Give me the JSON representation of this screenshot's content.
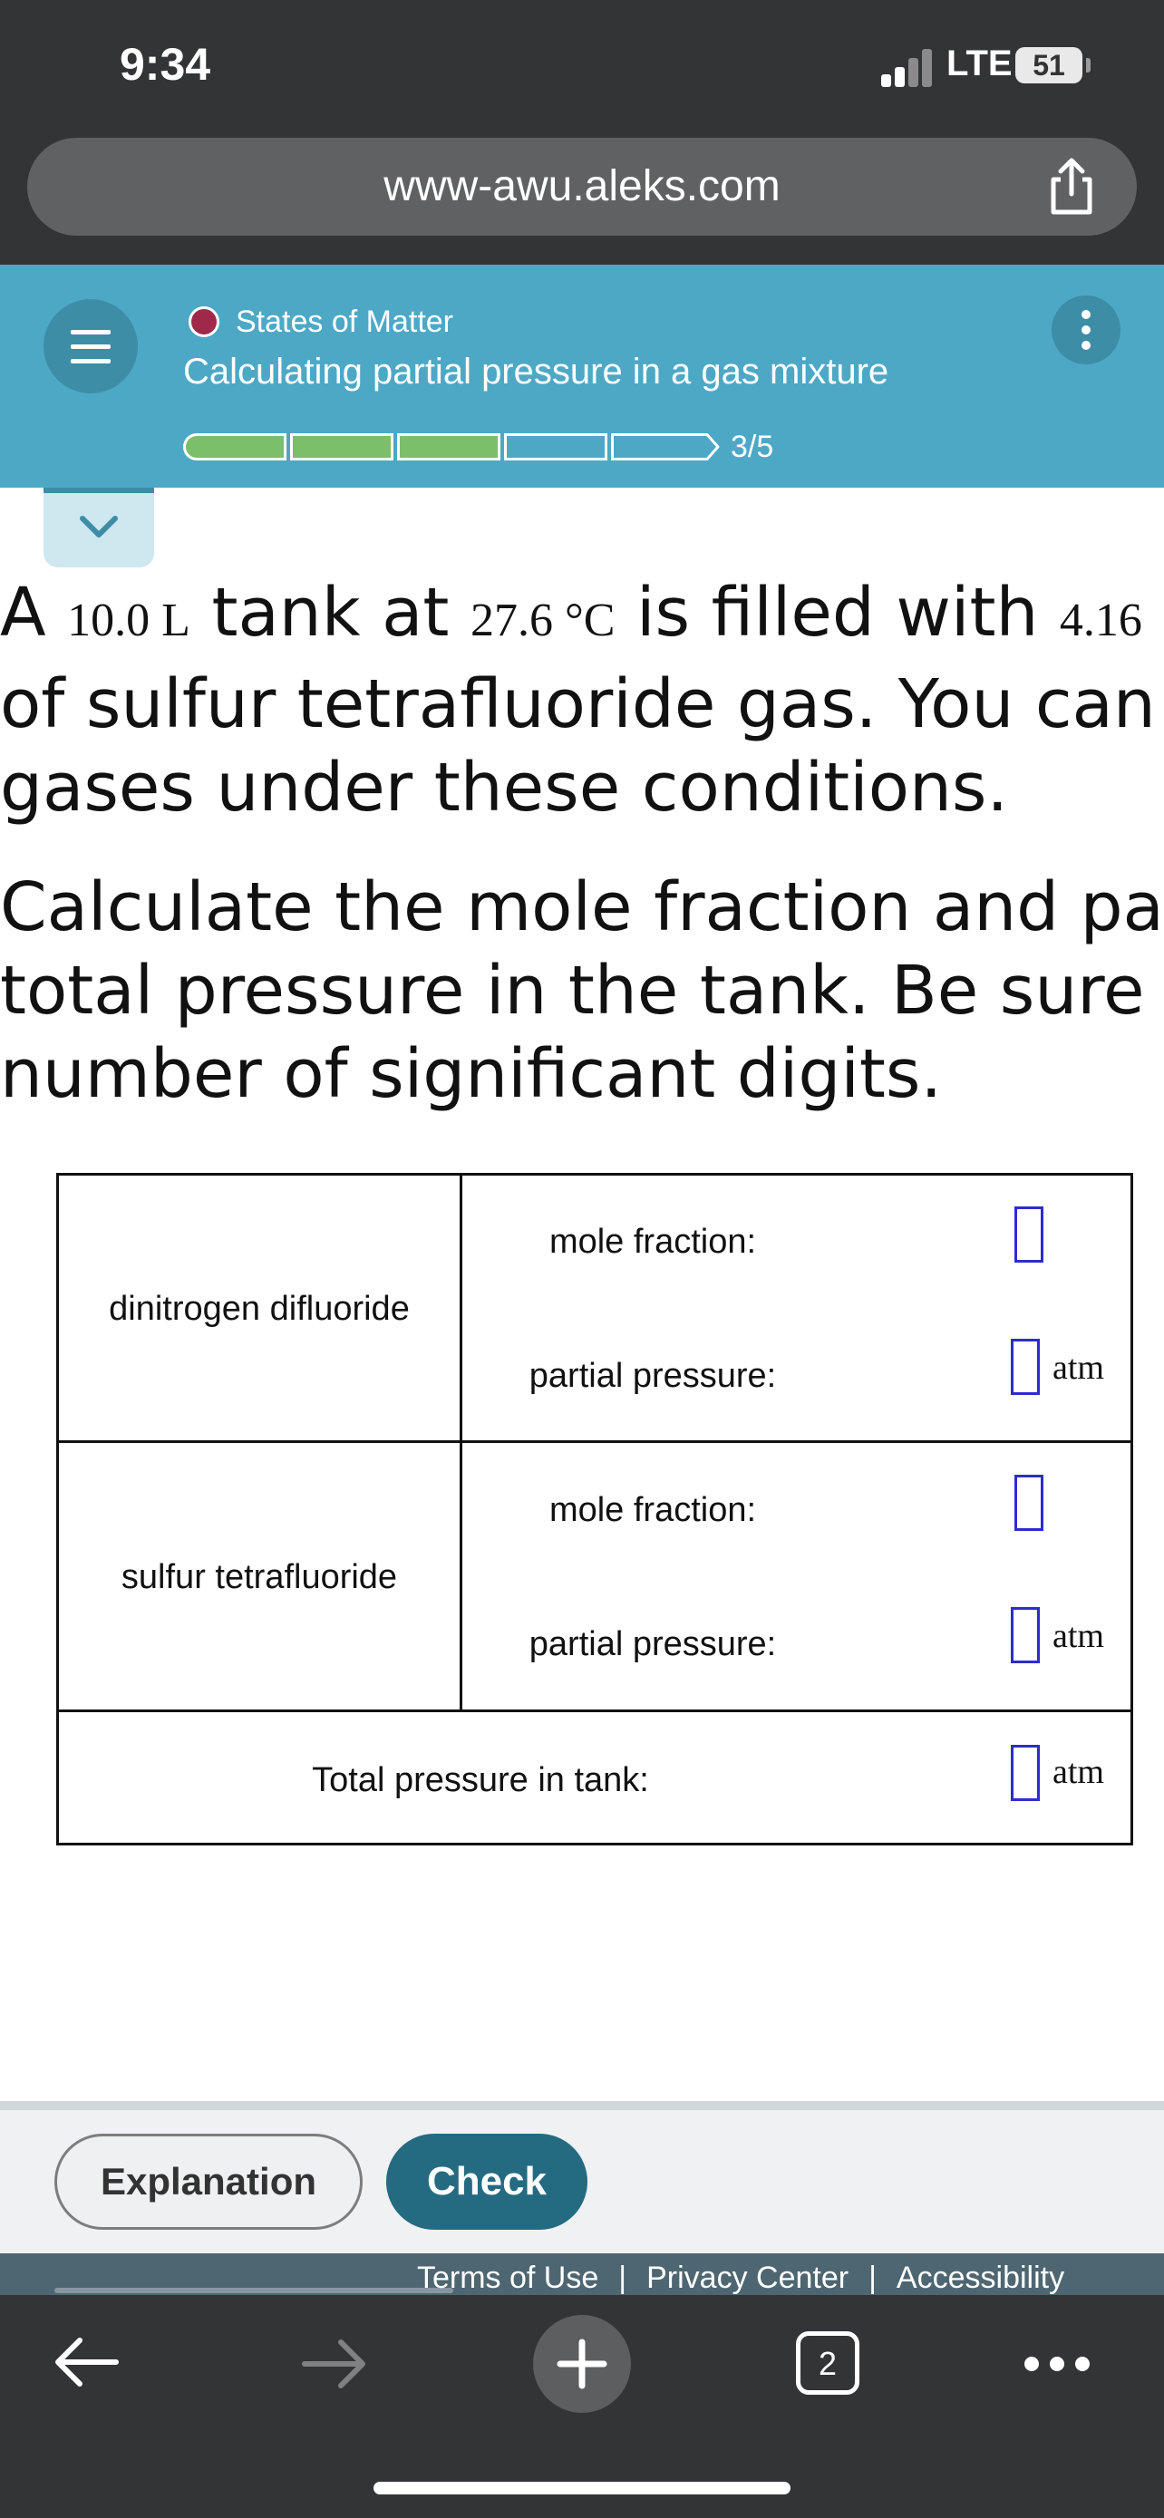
{
  "status_bar": {
    "time": "9:34",
    "network": "LTE",
    "battery": "51"
  },
  "url_bar": {
    "url": "www-awu.aleks.com"
  },
  "header": {
    "topic": "States of Matter",
    "lesson_title": "Calculating partial pressure in a gas mixture",
    "progress_label": "3/5",
    "progress": {
      "completed": 3,
      "total": 5
    },
    "accent_color": "#4da8c6",
    "topic_dot_color": "#a0284a"
  },
  "problem": {
    "line1": {
      "a": "A ",
      "volume": "10.0 L",
      "b": " tank at ",
      "temp": "27.6 °C",
      "c": " is filled with ",
      "mass": "4.16"
    },
    "line2": "of sulfur tetrafluoride gas. You can a",
    "line3": "gases under these conditions.",
    "line4": "Calculate the mole fraction and part",
    "line5": "total pressure in the tank. Be sure y",
    "line6": "number of significant digits."
  },
  "table": {
    "rows": [
      {
        "gas": "dinitrogen difluoride",
        "mole_fraction_label": "mole fraction:",
        "partial_pressure_label": "partial pressure:",
        "unit": "atm"
      },
      {
        "gas": "sulfur tetrafluoride",
        "mole_fraction_label": "mole fraction:",
        "partial_pressure_label": "partial pressure:",
        "unit": "atm"
      }
    ],
    "total": {
      "label": "Total pressure in tank:",
      "unit": "atm"
    }
  },
  "actions": {
    "explanation_label": "Explanation",
    "check_label": "Check"
  },
  "footer": {
    "links": [
      "Terms of Use",
      "Privacy Center",
      "Accessibility"
    ],
    "separator": "|"
  },
  "toolbar": {
    "tab_count": "2",
    "icons": [
      "back-arrow-icon",
      "forward-arrow-icon",
      "new-tab-plus-icon",
      "tabs-icon",
      "more-icon"
    ]
  }
}
